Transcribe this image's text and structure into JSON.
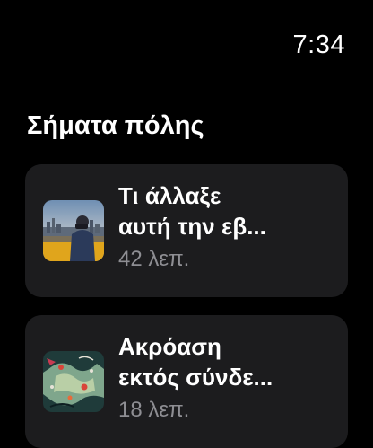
{
  "status_bar": {
    "time": "7:34"
  },
  "section": {
    "title": "Σήματα πόλης"
  },
  "episodes": [
    {
      "title_line1": "Τι άλλαξε",
      "title_line2": "αυτή την εβ...",
      "duration": "42 λεπ.",
      "artwork_icon": "city-portrait-artwork"
    },
    {
      "title_line1": "Ακρόαση",
      "title_line2": "εκτός σύνδε...",
      "duration": "18 λεπ.",
      "artwork_icon": "map-abstract-artwork"
    }
  ]
}
